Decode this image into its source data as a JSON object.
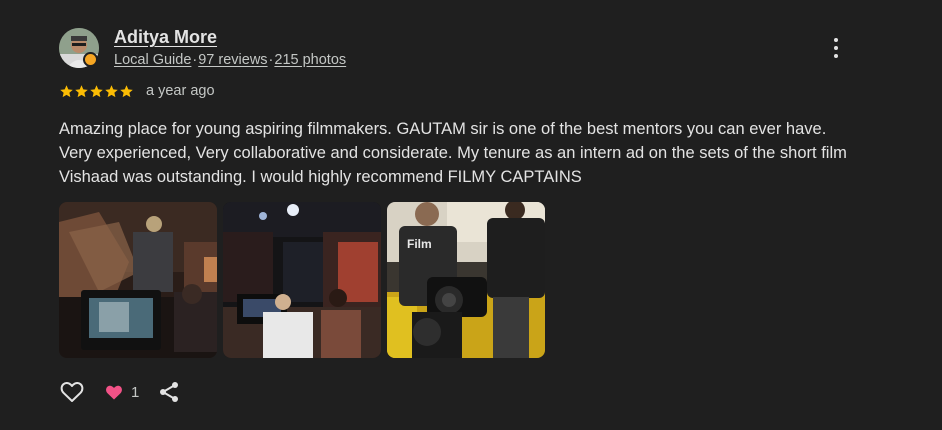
{
  "author": {
    "name": "Aditya More",
    "badge": "Local Guide",
    "reviews": "97 reviews",
    "photos": "215 photos",
    "separator": "·"
  },
  "rating": {
    "stars": 5,
    "max": 5,
    "time_ago": "a year ago",
    "star_color": "#fbbc04"
  },
  "review_text": "Amazing place for young aspiring filmmakers. GAUTAM sir is one of the best mentors you can ever have. Very experienced, Very collaborative and considerate. My tenure as an intern ad on the sets of the short film Vishaad was outstanding. I would highly recommend FILMY CAPTAINS",
  "photos": [
    {
      "icon": "photo-film-set-monitor"
    },
    {
      "icon": "photo-film-set-stage"
    },
    {
      "icon": "photo-film-crew-camera",
      "shirt_text": "Film"
    }
  ],
  "actions": {
    "like_icon": "heart-outline-icon",
    "reaction_icon": "heart-filled-icon",
    "reaction_count": "1",
    "reaction_color": "#f25287",
    "share_icon": "share-icon"
  },
  "colors": {
    "background": "#1f1f1f",
    "text": "#e3e3e3",
    "muted": "#c4c7c5"
  }
}
